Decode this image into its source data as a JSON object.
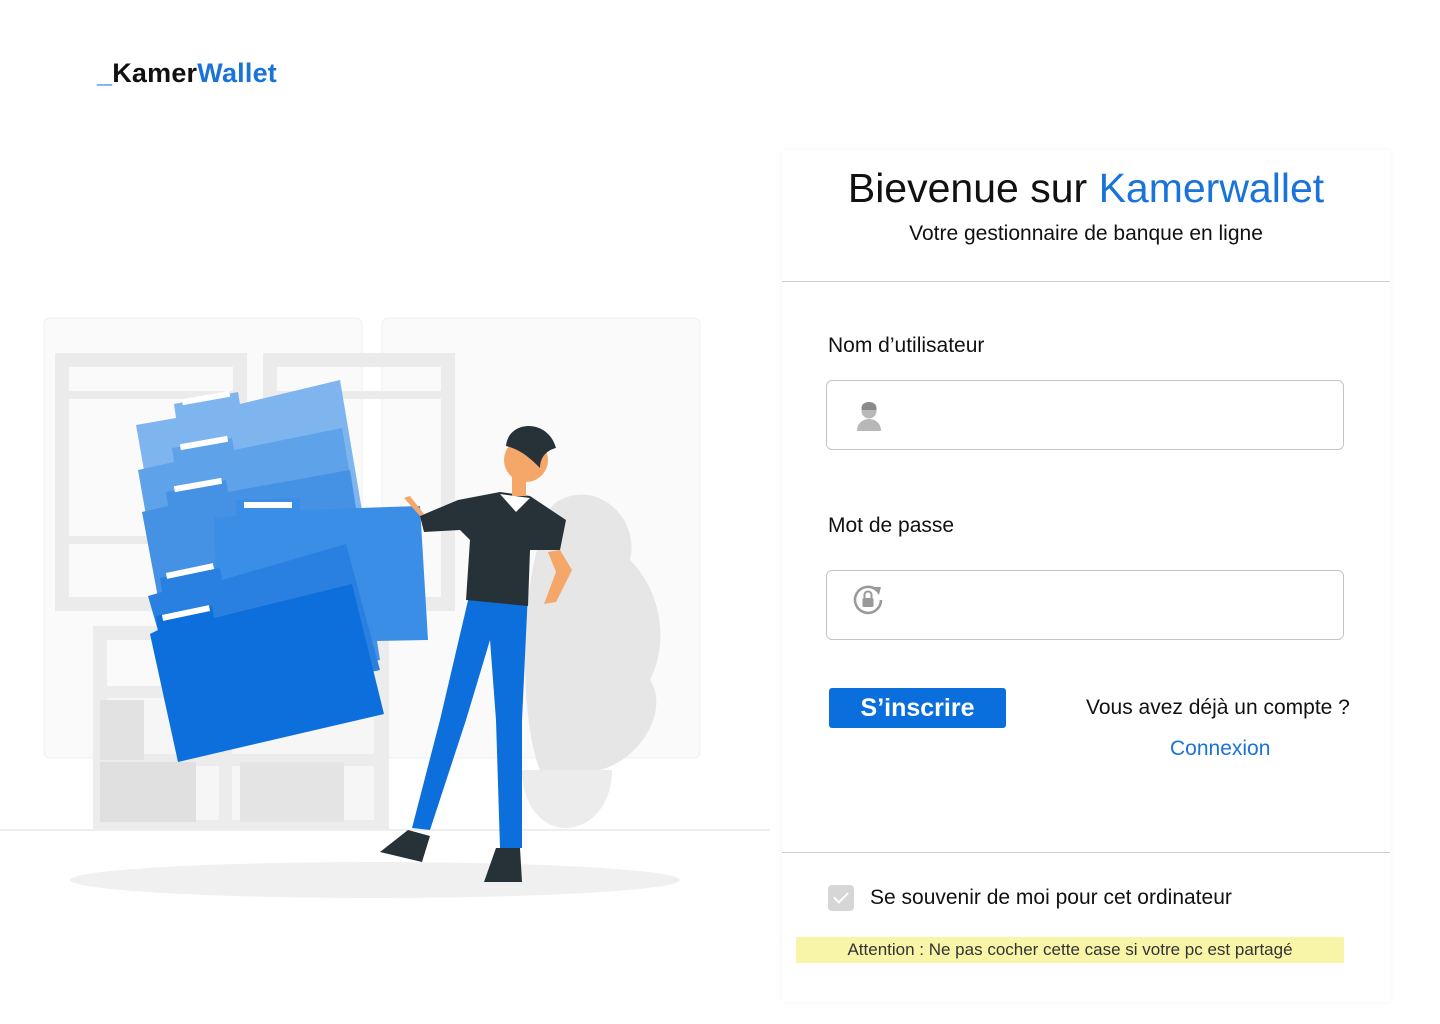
{
  "logo": {
    "prefix": "_",
    "part1": "Kamer",
    "part2": "Wallet"
  },
  "card": {
    "title_prefix": "Bievenue sur ",
    "title_brand": "Kamerwallet",
    "subtitle": "Votre gestionnaire de banque en ligne"
  },
  "form": {
    "username_label": "Nom d’utilisateur",
    "username_value": "",
    "username_icon": "user-icon",
    "password_label": "Mot de passe",
    "password_value": "",
    "password_icon": "lock-refresh-icon",
    "register_label": "S’inscrire",
    "have_account_text": "Vous avez déjà un compte ?",
    "login_link": "Connexion"
  },
  "footer": {
    "remember_label": "Se souvenir de moi pour cet ordinateur",
    "remember_checked": true,
    "warning": "Attention : Ne pas cocher cette case  si votre pc  est partagé"
  },
  "colors": {
    "brand": "#1a73d9",
    "button": "#0a6fdc",
    "warning_bg": "#f8f5a8"
  }
}
